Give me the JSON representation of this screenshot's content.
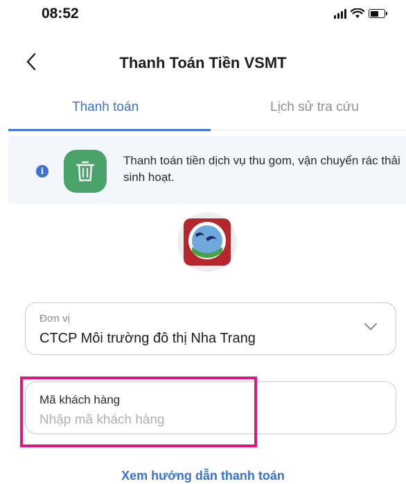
{
  "status_bar": {
    "time": "08:52",
    "icons": [
      "signal-icon",
      "wifi-icon",
      "battery-icon"
    ]
  },
  "header": {
    "title": "Thanh Toán Tiền VSMT",
    "back_icon": "chevron-left-icon"
  },
  "tabs": [
    {
      "label": "Thanh toán",
      "active": true
    },
    {
      "label": "Lịch sử tra cứu",
      "active": false
    }
  ],
  "banner": {
    "info_icon": "info-icon",
    "tile_icon": "trash-icon",
    "text": "Thanh toán tiền dịch vụ thu gom, vận chuyển rác thải sinh hoạt."
  },
  "logo": {
    "icon": "company-logo"
  },
  "form": {
    "unit": {
      "label": "Đơn vị",
      "value": "CTCP Môi trường đô thị Nha Trang",
      "icon": "chevron-down-icon"
    },
    "customer_code": {
      "label": "Mã khách hàng",
      "value": "",
      "placeholder": "Nhập mã khách hàng"
    }
  },
  "guide_link": "Xem hướng dẫn thanh toán",
  "colors": {
    "accent": "#3a72d6",
    "tile_green": "#4aa36a",
    "highlight": "#e0157f",
    "banner_bg": "#f3f6fa"
  }
}
